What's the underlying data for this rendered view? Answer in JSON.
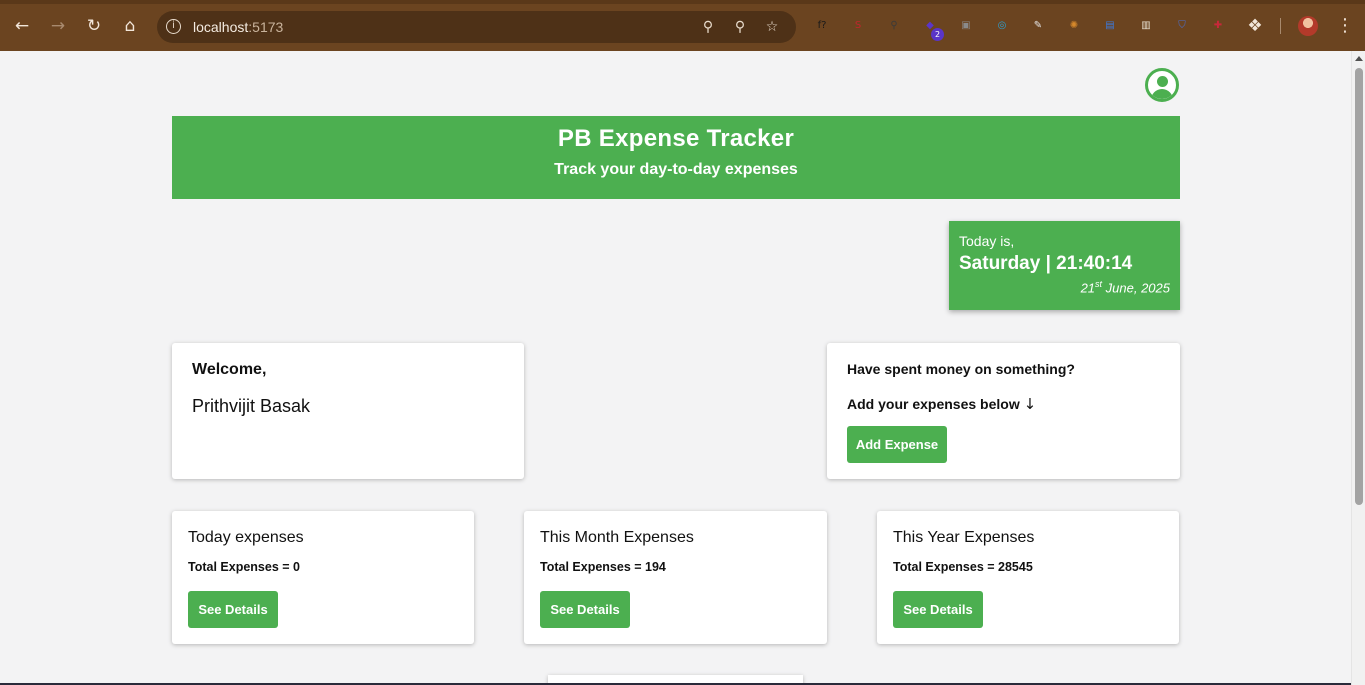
{
  "browser": {
    "url_host": "localhost",
    "url_port": ":5173",
    "extensions": [
      {
        "name": "font-finder",
        "glyph": "f?",
        "color": "#1a1a1a"
      },
      {
        "name": "seo",
        "glyph": "S",
        "color": "#c0262c"
      },
      {
        "name": "search-ext",
        "glyph": "⚲",
        "color": "#3a3a3a"
      },
      {
        "name": "gem",
        "glyph": "◆",
        "color": "#5a35c8",
        "badge": "2"
      },
      {
        "name": "camera",
        "glyph": "▣",
        "color": "#8a8a8a"
      },
      {
        "name": "color-ring",
        "glyph": "◎",
        "color": "#2aa3d8"
      },
      {
        "name": "eyedropper",
        "glyph": "✎",
        "color": "#e6e6e6"
      },
      {
        "name": "color-wheel",
        "glyph": "✺",
        "color": "#d6892b"
      },
      {
        "name": "docs",
        "glyph": "▤",
        "color": "#3b7be0"
      },
      {
        "name": "notes",
        "glyph": "▥",
        "color": "#e8e0d0"
      },
      {
        "name": "shield",
        "glyph": "⛉",
        "color": "#4a6fd0"
      },
      {
        "name": "puzzle-red",
        "glyph": "✚",
        "color": "#c8283a"
      }
    ]
  },
  "header": {
    "title": "PB Expense Tracker",
    "subtitle": "Track your day-to-day expenses"
  },
  "date_card": {
    "label": "Today is,",
    "day_time": "Saturday | 21:40:14",
    "day": "21",
    "ordinal": "st",
    "month_year": " June, 2025"
  },
  "welcome": {
    "title": "Welcome,",
    "name": "Prithvijit Basak"
  },
  "add_expense": {
    "question": "Have spent money on something?",
    "prompt": "Add your expenses below",
    "arrow": "↓",
    "button": "Add Expense"
  },
  "stats": {
    "today": {
      "title": "Today expenses",
      "total": "Total Expenses = 0",
      "button": "See Details"
    },
    "month": {
      "title": "This Month Expenses",
      "total": "Total Expenses = 194",
      "button": "See Details"
    },
    "year": {
      "title": "This Year Expenses",
      "total": "Total Expenses = 28545",
      "button": "See Details"
    }
  },
  "colors": {
    "accent": "#4caf50",
    "chrome": "#6b4420"
  }
}
